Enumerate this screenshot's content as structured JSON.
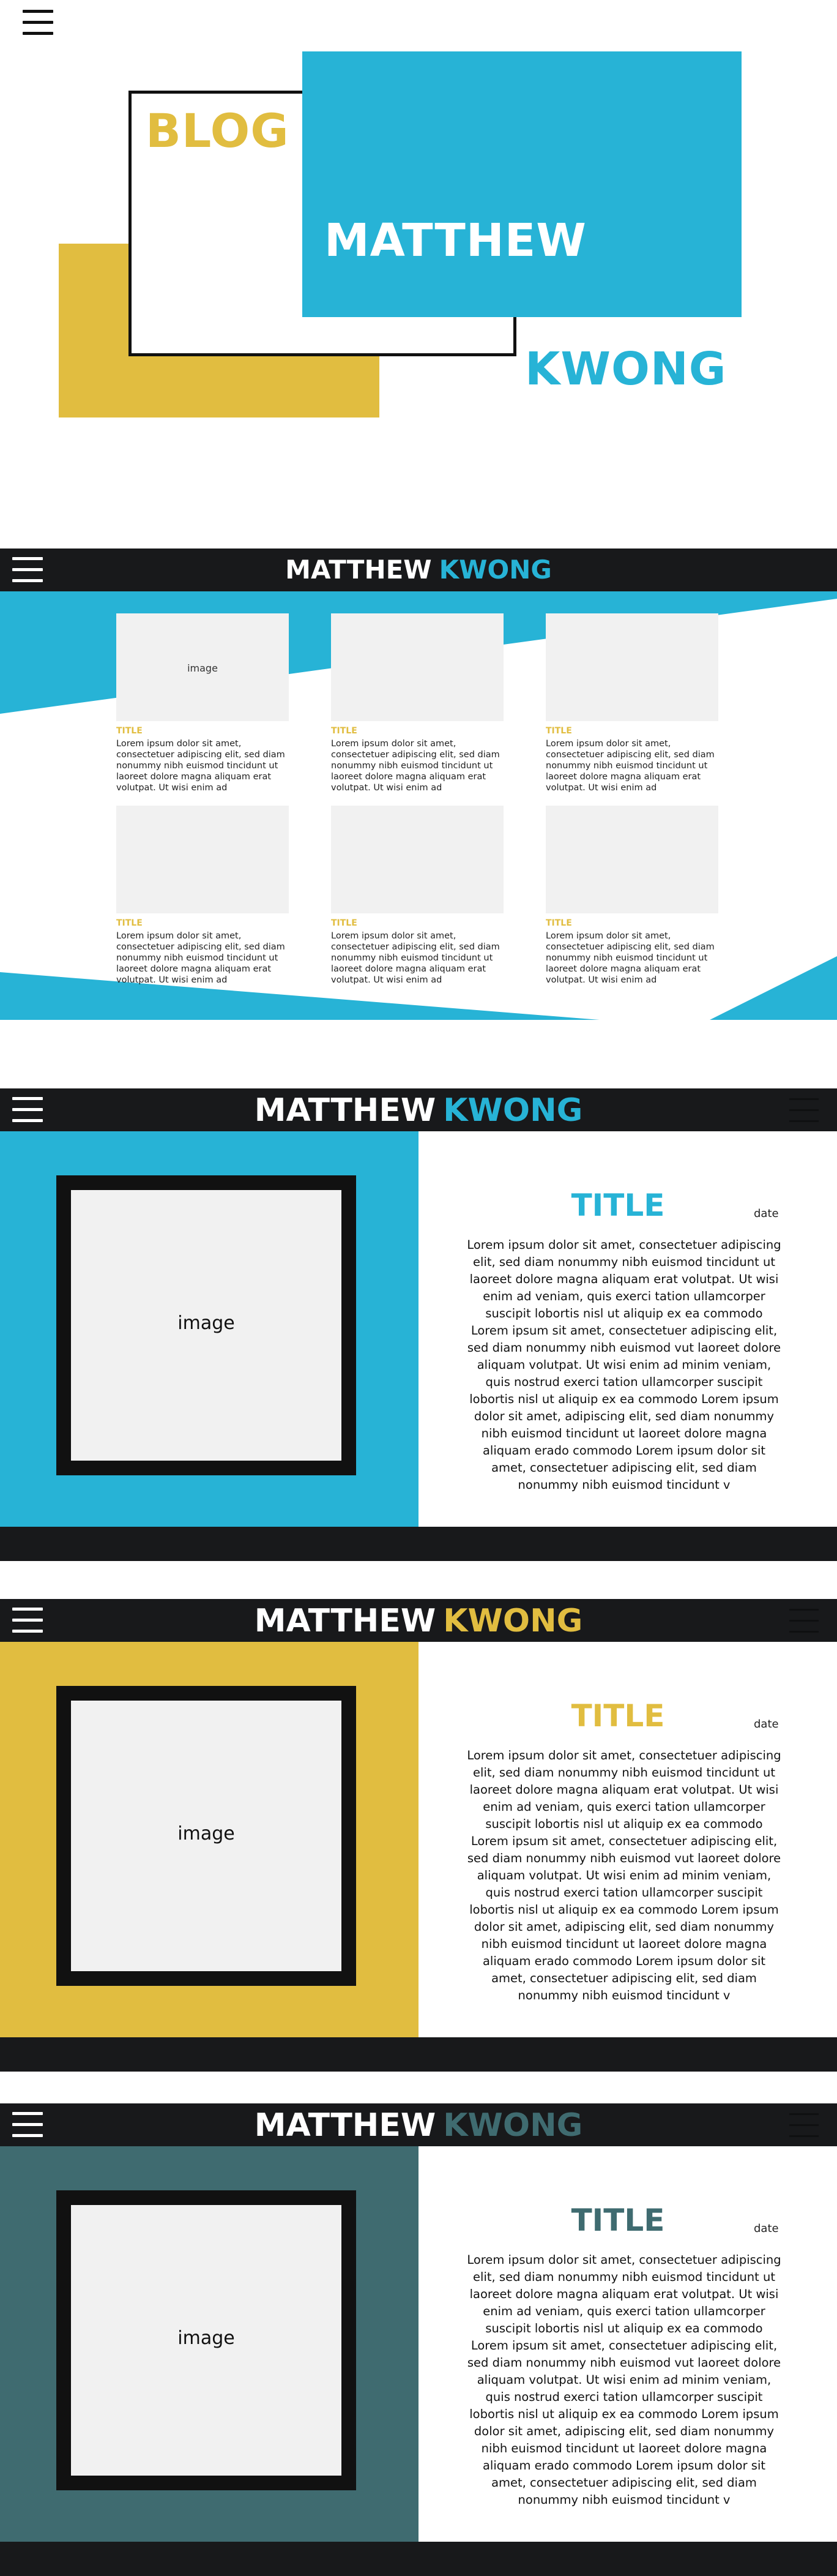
{
  "hero": {
    "blog": "BLOG",
    "first_name": "MATTHEW",
    "last_name": "KWONG"
  },
  "colors": {
    "blue": "#27b3d6",
    "yellow": "#e1bd40",
    "teal": "#3f6b70",
    "dark": "#18191b",
    "placeholder": "#f1f1f1"
  },
  "blog_page": {
    "header_first": "MATTHEW",
    "header_last": "KWONG",
    "cards": [
      {
        "image": "image",
        "title": "TITLE",
        "text": "Lorem ipsum dolor sit amet, consectetuer adipiscing elit, sed diam nonummy nibh euismod tincidunt ut laoreet dolore magna aliquam erat volutpat. Ut wisi enim ad"
      },
      {
        "image": "",
        "title": "TITLE",
        "text": "Lorem ipsum dolor sit amet, consectetuer adipiscing elit, sed diam nonummy nibh euismod tincidunt ut laoreet dolore magna aliquam erat volutpat. Ut wisi enim ad"
      },
      {
        "image": "",
        "title": "TITLE",
        "text": "Lorem ipsum dolor sit amet, consectetuer adipiscing elit, sed diam nonummy nibh euismod tincidunt ut laoreet dolore magna aliquam erat volutpat. Ut wisi enim ad"
      },
      {
        "image": "",
        "title": "TITLE",
        "text": "Lorem ipsum dolor sit amet, consectetuer adipiscing elit, sed diam nonummy nibh euismod tincidunt ut laoreet dolore magna aliquam erat volutpat. Ut wisi enim ad"
      },
      {
        "image": "",
        "title": "TITLE",
        "text": "Lorem ipsum dolor sit amet, consectetuer adipiscing elit, sed diam nonummy nibh euismod tincidunt ut laoreet dolore magna aliquam erat volutpat. Ut wisi enim ad"
      },
      {
        "image": "",
        "title": "TITLE",
        "text": "Lorem ipsum dolor sit amet, consectetuer adipiscing elit, sed diam nonummy nibh euismod tincidunt ut laoreet dolore magna aliquam erat volutpat. Ut wisi enim ad"
      }
    ]
  },
  "post_pages": [
    {
      "header_first": "MATTHEW",
      "header_last": "KWONG",
      "accent": "#27b3d6",
      "image": "image",
      "title": "TITLE",
      "date": "date",
      "body": "Lorem ipsum dolor sit amet, consectetuer adipiscing elit, sed diam nonummy nibh euismod tincidunt ut laoreet dolore magna aliquam erat volutpat. Ut wisi enim ad veniam, quis exerci tation ullamcorper suscipit lobortis nisl ut aliquip ex ea commodo Lorem ipsum sit amet, consectetuer adipiscing elit, sed diam nonummy nibh euismod vut laoreet dolore aliquam volutpat. Ut wisi enim ad minim veniam, quis nostrud exerci tation ullamcorper suscipit lobortis nisl ut aliquip ex ea commodo Lorem ipsum dolor sit amet, adipiscing elit, sed diam nonummy nibh euismod tincidunt ut laoreet dolore magna aliquam erado commodo Lorem ipsum dolor sit amet, consectetuer adipiscing elit, sed diam nonummy nibh euismod tincidunt v"
    },
    {
      "header_first": "MATTHEW",
      "header_last": "KWONG",
      "accent": "#e1bd40",
      "image": "image",
      "title": "TITLE",
      "date": "date",
      "body": "Lorem ipsum dolor sit amet, consectetuer adipiscing elit, sed diam nonummy nibh euismod tincidunt ut laoreet dolore magna aliquam erat volutpat. Ut wisi enim ad veniam, quis exerci tation ullamcorper suscipit lobortis nisl ut aliquip ex ea commodo Lorem ipsum sit amet, consectetuer adipiscing elit, sed diam nonummy nibh euismod vut laoreet dolore aliquam volutpat. Ut wisi enim ad minim veniam, quis nostrud exerci tation ullamcorper suscipit lobortis nisl ut aliquip ex ea commodo Lorem ipsum dolor sit amet, adipiscing elit, sed diam nonummy nibh euismod tincidunt ut laoreet dolore magna aliquam erado commodo Lorem ipsum dolor sit amet, consectetuer adipiscing elit, sed diam nonummy nibh euismod tincidunt v"
    },
    {
      "header_first": "MATTHEW",
      "header_last": "KWONG",
      "accent": "#3f6b70",
      "image": "image",
      "title": "TITLE",
      "date": "date",
      "body": "Lorem ipsum dolor sit amet, consectetuer adipiscing elit, sed diam nonummy nibh euismod tincidunt ut laoreet dolore magna aliquam erat volutpat. Ut wisi enim ad veniam, quis exerci tation ullamcorper suscipit lobortis nisl ut aliquip ex ea commodo Lorem ipsum sit amet, consectetuer adipiscing elit, sed diam nonummy nibh euismod vut laoreet dolore aliquam volutpat. Ut wisi enim ad minim veniam, quis nostrud exerci tation ullamcorper suscipit lobortis nisl ut aliquip ex ea commodo Lorem ipsum dolor sit amet, adipiscing elit, sed diam nonummy nibh euismod tincidunt ut laoreet dolore magna aliquam erado commodo Lorem ipsum dolor sit amet, consectetuer adipiscing elit, sed diam nonummy nibh euismod tincidunt v"
    }
  ]
}
